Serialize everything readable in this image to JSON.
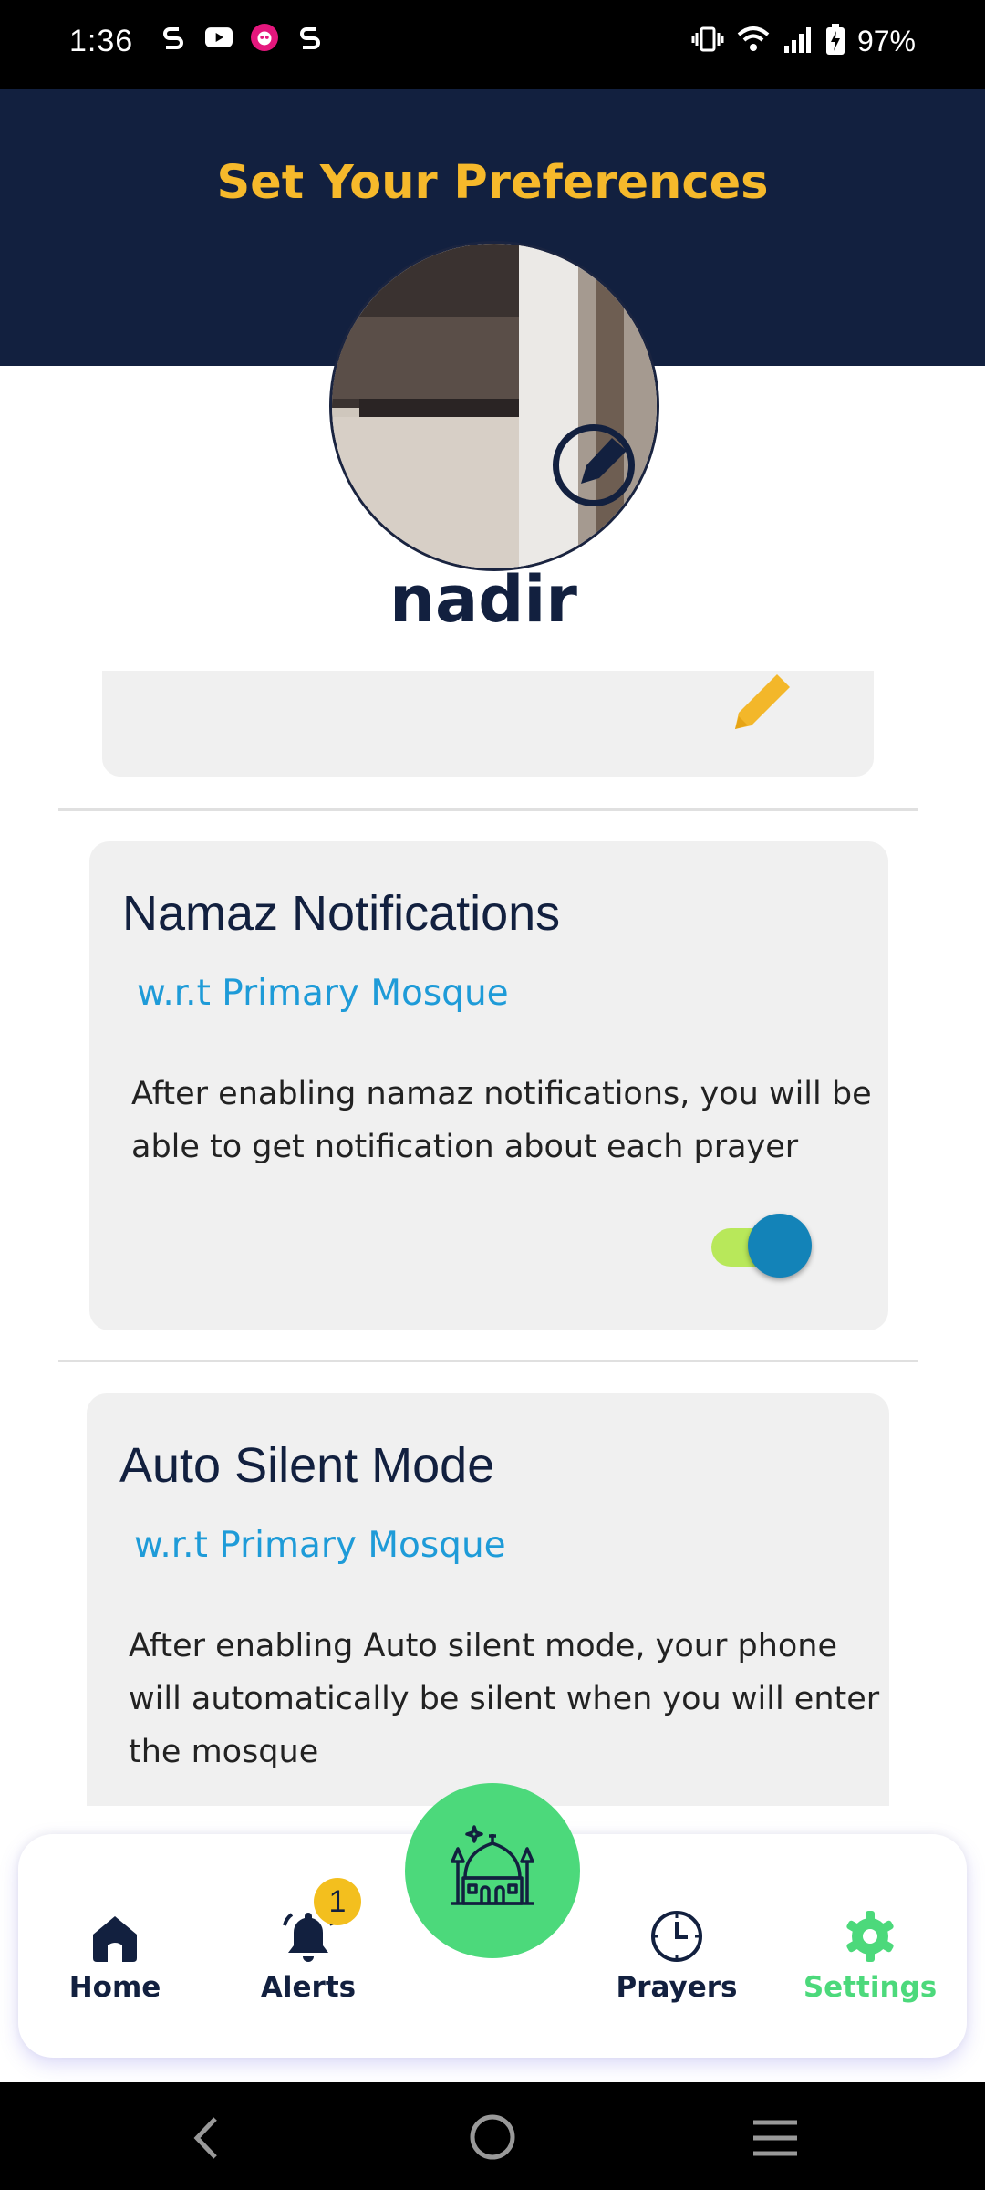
{
  "status_bar": {
    "time": "1:36",
    "battery": "97%",
    "left_icons": [
      "s-app-icon",
      "youtube-icon",
      "foodpanda-icon",
      "s-app-icon"
    ],
    "right_icons": [
      "vibrate-icon",
      "wifi-icon",
      "signal-icon",
      "battery-charging-icon"
    ]
  },
  "header": {
    "title": "Set Your Preferences",
    "background": "#12203f",
    "title_color": "#f6b92b"
  },
  "profile": {
    "name": "nadir"
  },
  "namaz_card": {
    "title": "Namaz Notifications",
    "subtitle": "w.r.t Primary Mosque",
    "description_line1": "After enabling namaz notifications, you will be",
    "description_line2": "able to get notification about each prayer",
    "toggle_on": true
  },
  "silent_card": {
    "title": "Auto Silent Mode",
    "subtitle": "w.r.t Primary Mosque",
    "description_line1": "After enabling Auto silent mode, your phone",
    "description_line2": "will automatically be silent when you will enter",
    "description_line3": "the mosque"
  },
  "bottom_nav": {
    "home": "Home",
    "alerts": "Alerts",
    "alerts_badge": "1",
    "prayers": "Prayers",
    "settings": "Settings",
    "active": "settings",
    "active_color": "#4cd97b"
  },
  "colors": {
    "accent_blue": "#1e9bd8",
    "navy": "#12203f",
    "yellow": "#f6b92b",
    "green": "#4cd97b"
  }
}
